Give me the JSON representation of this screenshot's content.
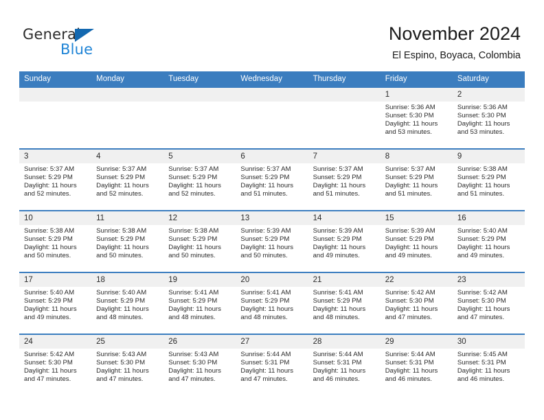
{
  "brand": {
    "name_part1": "General",
    "name_part2": "Blue",
    "triangle_color": "#1368b0",
    "blue_color": "#1f84d6"
  },
  "header": {
    "title": "November 2024",
    "subtitle": "El Espino, Boyaca, Colombia"
  },
  "theme": {
    "header_blue": "#3b7dbf",
    "daynum_band": "#f0f0f0",
    "text": "#2a2a2a"
  },
  "weekdays": [
    "Sunday",
    "Monday",
    "Tuesday",
    "Wednesday",
    "Thursday",
    "Friday",
    "Saturday"
  ],
  "weeks": [
    [
      {
        "day": "",
        "sunrise": "",
        "sunset": "",
        "daylight1": "",
        "daylight2": ""
      },
      {
        "day": "",
        "sunrise": "",
        "sunset": "",
        "daylight1": "",
        "daylight2": ""
      },
      {
        "day": "",
        "sunrise": "",
        "sunset": "",
        "daylight1": "",
        "daylight2": ""
      },
      {
        "day": "",
        "sunrise": "",
        "sunset": "",
        "daylight1": "",
        "daylight2": ""
      },
      {
        "day": "",
        "sunrise": "",
        "sunset": "",
        "daylight1": "",
        "daylight2": ""
      },
      {
        "day": "1",
        "sunrise": "Sunrise: 5:36 AM",
        "sunset": "Sunset: 5:30 PM",
        "daylight1": "Daylight: 11 hours",
        "daylight2": "and 53 minutes."
      },
      {
        "day": "2",
        "sunrise": "Sunrise: 5:36 AM",
        "sunset": "Sunset: 5:30 PM",
        "daylight1": "Daylight: 11 hours",
        "daylight2": "and 53 minutes."
      }
    ],
    [
      {
        "day": "3",
        "sunrise": "Sunrise: 5:37 AM",
        "sunset": "Sunset: 5:29 PM",
        "daylight1": "Daylight: 11 hours",
        "daylight2": "and 52 minutes."
      },
      {
        "day": "4",
        "sunrise": "Sunrise: 5:37 AM",
        "sunset": "Sunset: 5:29 PM",
        "daylight1": "Daylight: 11 hours",
        "daylight2": "and 52 minutes."
      },
      {
        "day": "5",
        "sunrise": "Sunrise: 5:37 AM",
        "sunset": "Sunset: 5:29 PM",
        "daylight1": "Daylight: 11 hours",
        "daylight2": "and 52 minutes."
      },
      {
        "day": "6",
        "sunrise": "Sunrise: 5:37 AM",
        "sunset": "Sunset: 5:29 PM",
        "daylight1": "Daylight: 11 hours",
        "daylight2": "and 51 minutes."
      },
      {
        "day": "7",
        "sunrise": "Sunrise: 5:37 AM",
        "sunset": "Sunset: 5:29 PM",
        "daylight1": "Daylight: 11 hours",
        "daylight2": "and 51 minutes."
      },
      {
        "day": "8",
        "sunrise": "Sunrise: 5:37 AM",
        "sunset": "Sunset: 5:29 PM",
        "daylight1": "Daylight: 11 hours",
        "daylight2": "and 51 minutes."
      },
      {
        "day": "9",
        "sunrise": "Sunrise: 5:38 AM",
        "sunset": "Sunset: 5:29 PM",
        "daylight1": "Daylight: 11 hours",
        "daylight2": "and 51 minutes."
      }
    ],
    [
      {
        "day": "10",
        "sunrise": "Sunrise: 5:38 AM",
        "sunset": "Sunset: 5:29 PM",
        "daylight1": "Daylight: 11 hours",
        "daylight2": "and 50 minutes."
      },
      {
        "day": "11",
        "sunrise": "Sunrise: 5:38 AM",
        "sunset": "Sunset: 5:29 PM",
        "daylight1": "Daylight: 11 hours",
        "daylight2": "and 50 minutes."
      },
      {
        "day": "12",
        "sunrise": "Sunrise: 5:38 AM",
        "sunset": "Sunset: 5:29 PM",
        "daylight1": "Daylight: 11 hours",
        "daylight2": "and 50 minutes."
      },
      {
        "day": "13",
        "sunrise": "Sunrise: 5:39 AM",
        "sunset": "Sunset: 5:29 PM",
        "daylight1": "Daylight: 11 hours",
        "daylight2": "and 50 minutes."
      },
      {
        "day": "14",
        "sunrise": "Sunrise: 5:39 AM",
        "sunset": "Sunset: 5:29 PM",
        "daylight1": "Daylight: 11 hours",
        "daylight2": "and 49 minutes."
      },
      {
        "day": "15",
        "sunrise": "Sunrise: 5:39 AM",
        "sunset": "Sunset: 5:29 PM",
        "daylight1": "Daylight: 11 hours",
        "daylight2": "and 49 minutes."
      },
      {
        "day": "16",
        "sunrise": "Sunrise: 5:40 AM",
        "sunset": "Sunset: 5:29 PM",
        "daylight1": "Daylight: 11 hours",
        "daylight2": "and 49 minutes."
      }
    ],
    [
      {
        "day": "17",
        "sunrise": "Sunrise: 5:40 AM",
        "sunset": "Sunset: 5:29 PM",
        "daylight1": "Daylight: 11 hours",
        "daylight2": "and 49 minutes."
      },
      {
        "day": "18",
        "sunrise": "Sunrise: 5:40 AM",
        "sunset": "Sunset: 5:29 PM",
        "daylight1": "Daylight: 11 hours",
        "daylight2": "and 48 minutes."
      },
      {
        "day": "19",
        "sunrise": "Sunrise: 5:41 AM",
        "sunset": "Sunset: 5:29 PM",
        "daylight1": "Daylight: 11 hours",
        "daylight2": "and 48 minutes."
      },
      {
        "day": "20",
        "sunrise": "Sunrise: 5:41 AM",
        "sunset": "Sunset: 5:29 PM",
        "daylight1": "Daylight: 11 hours",
        "daylight2": "and 48 minutes."
      },
      {
        "day": "21",
        "sunrise": "Sunrise: 5:41 AM",
        "sunset": "Sunset: 5:29 PM",
        "daylight1": "Daylight: 11 hours",
        "daylight2": "and 48 minutes."
      },
      {
        "day": "22",
        "sunrise": "Sunrise: 5:42 AM",
        "sunset": "Sunset: 5:30 PM",
        "daylight1": "Daylight: 11 hours",
        "daylight2": "and 47 minutes."
      },
      {
        "day": "23",
        "sunrise": "Sunrise: 5:42 AM",
        "sunset": "Sunset: 5:30 PM",
        "daylight1": "Daylight: 11 hours",
        "daylight2": "and 47 minutes."
      }
    ],
    [
      {
        "day": "24",
        "sunrise": "Sunrise: 5:42 AM",
        "sunset": "Sunset: 5:30 PM",
        "daylight1": "Daylight: 11 hours",
        "daylight2": "and 47 minutes."
      },
      {
        "day": "25",
        "sunrise": "Sunrise: 5:43 AM",
        "sunset": "Sunset: 5:30 PM",
        "daylight1": "Daylight: 11 hours",
        "daylight2": "and 47 minutes."
      },
      {
        "day": "26",
        "sunrise": "Sunrise: 5:43 AM",
        "sunset": "Sunset: 5:30 PM",
        "daylight1": "Daylight: 11 hours",
        "daylight2": "and 47 minutes."
      },
      {
        "day": "27",
        "sunrise": "Sunrise: 5:44 AM",
        "sunset": "Sunset: 5:31 PM",
        "daylight1": "Daylight: 11 hours",
        "daylight2": "and 47 minutes."
      },
      {
        "day": "28",
        "sunrise": "Sunrise: 5:44 AM",
        "sunset": "Sunset: 5:31 PM",
        "daylight1": "Daylight: 11 hours",
        "daylight2": "and 46 minutes."
      },
      {
        "day": "29",
        "sunrise": "Sunrise: 5:44 AM",
        "sunset": "Sunset: 5:31 PM",
        "daylight1": "Daylight: 11 hours",
        "daylight2": "and 46 minutes."
      },
      {
        "day": "30",
        "sunrise": "Sunrise: 5:45 AM",
        "sunset": "Sunset: 5:31 PM",
        "daylight1": "Daylight: 11 hours",
        "daylight2": "and 46 minutes."
      }
    ]
  ]
}
